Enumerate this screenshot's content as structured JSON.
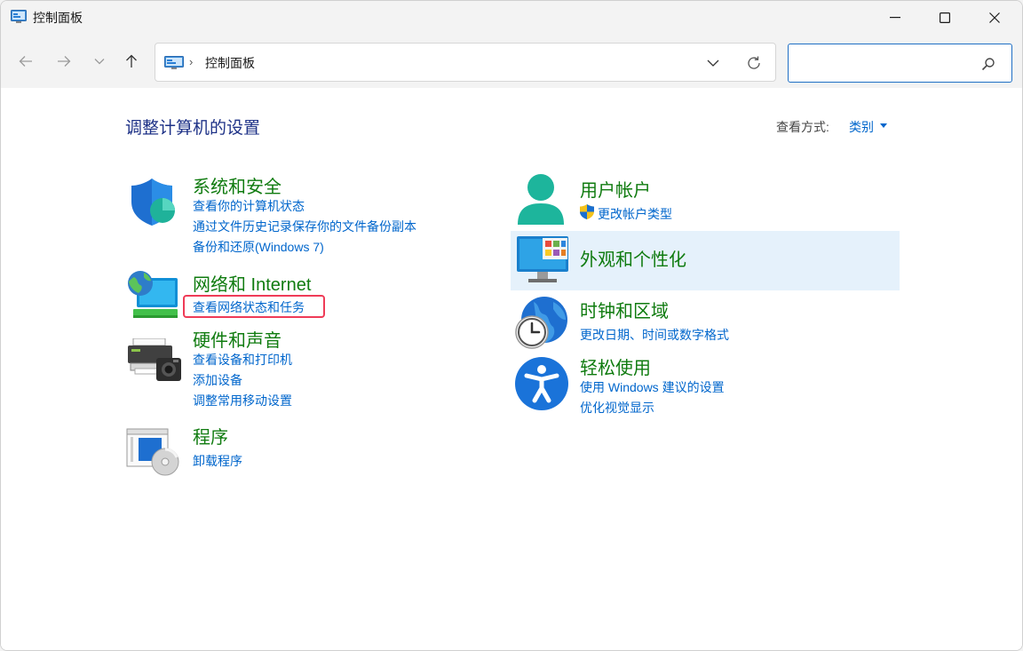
{
  "window": {
    "title": "控制面板"
  },
  "nav": {
    "address_path": "控制面板",
    "address_separator": "›",
    "search_placeholder": ""
  },
  "main": {
    "title": "调整计算机的设置",
    "view_by_label": "查看方式:",
    "view_by_value": "类别"
  },
  "left_categories": [
    {
      "title": "系统和安全",
      "links": [
        "查看你的计算机状态",
        "通过文件历史记录保存你的文件备份副本",
        "备份和还原(Windows 7)"
      ]
    },
    {
      "title": "网络和 Internet",
      "links": [
        "查看网络状态和任务"
      ]
    },
    {
      "title": "硬件和声音",
      "links": [
        "查看设备和打印机",
        "添加设备",
        "调整常用移动设置"
      ]
    },
    {
      "title": "程序",
      "links": [
        "卸载程序"
      ]
    }
  ],
  "right_categories": [
    {
      "title": "用户帐户",
      "links": [
        "更改帐户类型"
      ]
    },
    {
      "title": "外观和个性化",
      "links": []
    },
    {
      "title": "时钟和区域",
      "links": [
        "更改日期、时间或数字格式"
      ]
    },
    {
      "title": "轻松使用",
      "links": [
        "使用 Windows 建议的设置",
        "优化视觉显示"
      ]
    }
  ],
  "colors": {
    "category_title": "#0f7b0f",
    "link": "#0066cc",
    "page_title": "#1e3287",
    "highlight": "#ef3b57",
    "hover_bg": "#e5f1fb"
  }
}
